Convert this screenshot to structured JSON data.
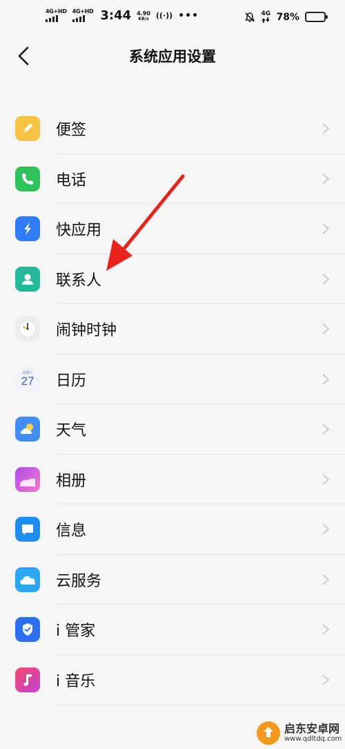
{
  "status_bar": {
    "net1": "4G+HD",
    "net2": "4G+HD",
    "time": "3:44",
    "speed_value": "4.90",
    "speed_unit": "KB/s",
    "wifi_call": "((·))",
    "more": "•••",
    "net_right": "4G",
    "battery": "78%",
    "battery_level": 0.78
  },
  "header": {
    "title": "系统应用设置"
  },
  "list": [
    {
      "label": "便签",
      "icon": "note-icon",
      "color": "#f5c242"
    },
    {
      "label": "电话",
      "icon": "phone-icon",
      "color": "#2fc25b"
    },
    {
      "label": "快应用",
      "icon": "quick-app-icon",
      "color": "#2f7df6"
    },
    {
      "label": "联系人",
      "icon": "contacts-icon",
      "color": "#22b89a"
    },
    {
      "label": "闹钟时钟",
      "icon": "clock-icon",
      "color": "#eeeeee"
    },
    {
      "label": "日历",
      "icon": "calendar-icon",
      "color": "#f1f3f8",
      "day": "27",
      "weekday": "星期六"
    },
    {
      "label": "天气",
      "icon": "weather-icon",
      "color": "#3f8df3"
    },
    {
      "label": "相册",
      "icon": "album-icon",
      "color": "#d465e6"
    },
    {
      "label": "信息",
      "icon": "message-icon",
      "color": "#1e8ff0"
    },
    {
      "label": "云服务",
      "icon": "cloud-icon",
      "color": "#2aa7f0"
    },
    {
      "label": "i 管家",
      "icon": "shield-icon",
      "color": "#2b6ef0"
    },
    {
      "label": "i 音乐",
      "icon": "music-icon",
      "color": "#ee4a7d"
    }
  ],
  "watermark": {
    "name": "启东安卓网",
    "url": "www.qdltdq.com"
  }
}
